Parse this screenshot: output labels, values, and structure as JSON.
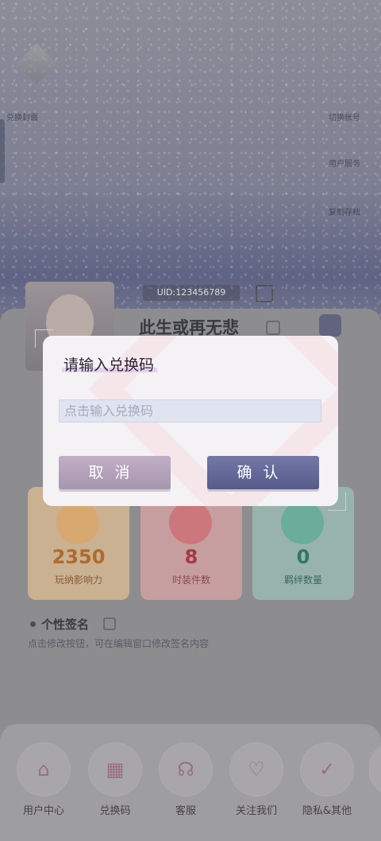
{
  "background": {
    "top_left_button": "兑换封面",
    "top_right_buttons": [
      "切换帐号",
      "用户服务",
      "复制存档"
    ],
    "uid": "UID:123456789",
    "player_name": "此生或再无悲",
    "stats": [
      {
        "value": "2350",
        "label": "玩纳影响力",
        "color": "#e1a15a",
        "bg": "#c9b192"
      },
      {
        "value": "8",
        "label": "时装件数",
        "color": "#d05e64",
        "bg": "#c69ea0"
      },
      {
        "value": "0",
        "label": "羁绊数量",
        "color": "#4aa88d",
        "bg": "#98b3ac"
      }
    ],
    "signature": {
      "title": "个性签名",
      "text": "点击修改按钮，可在编辑窗口修改签名内容"
    }
  },
  "tabbar": {
    "items": [
      {
        "label": "用户中心",
        "icon": "home-icon"
      },
      {
        "label": "兑换码",
        "icon": "redeem-code-icon"
      },
      {
        "label": "客服",
        "icon": "headset-icon"
      },
      {
        "label": "关注我们",
        "icon": "heart-plus-icon"
      },
      {
        "label": "隐私&其他",
        "icon": "shield-check-icon"
      }
    ]
  },
  "modal": {
    "title": "请输入兑换码",
    "input_placeholder": "点击输入兑换码",
    "input_value": "",
    "cancel_label": "取消",
    "confirm_label": "确认"
  }
}
